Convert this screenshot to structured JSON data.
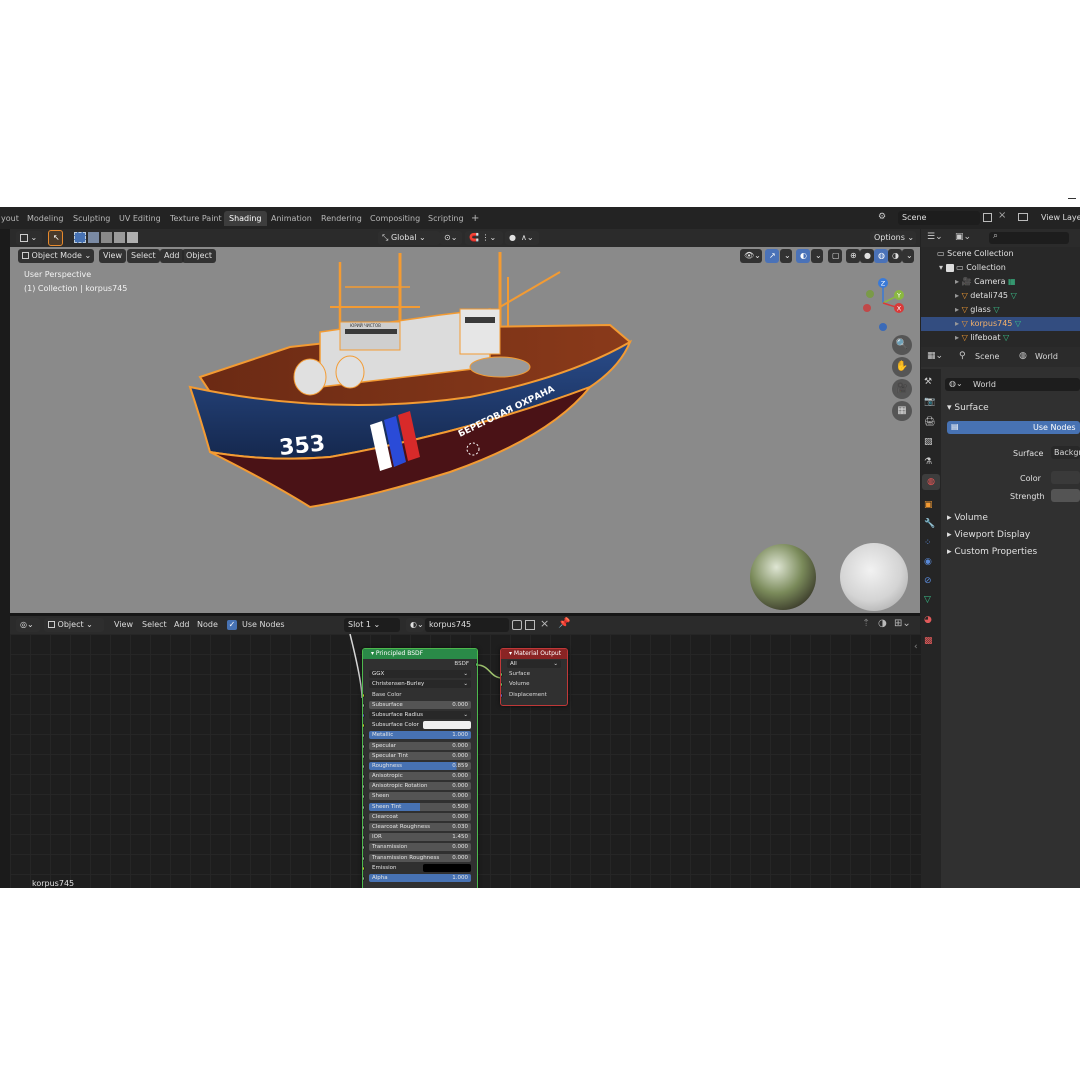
{
  "workspace_tabs": [
    "yout",
    "Modeling",
    "Sculpting",
    "UV Editing",
    "Texture Paint",
    "Shading",
    "Animation",
    "Rendering",
    "Compositing",
    "Scripting",
    "+"
  ],
  "active_tab": "Shading",
  "top_right": {
    "scene": "Scene",
    "view_layer": "View Layer"
  },
  "viewport": {
    "mode": "Object Mode",
    "menus": [
      "View",
      "Select",
      "Add",
      "Object"
    ],
    "transform_orientation": "Global",
    "options_label": "Options",
    "perspective_label": "User Perspective",
    "collection_label": "(1) Collection | korpus745",
    "hull_number": "353",
    "hull_text": "БЕРЕГОВАЯ ОХРАНА",
    "bridge_sign": "ЮРИЙ ЧИСТОВ",
    "gizmo": {
      "x": "X",
      "y": "Y",
      "z": "Z"
    }
  },
  "node_editor": {
    "editor_type": "Object",
    "menus": [
      "View",
      "Select",
      "Add",
      "Node"
    ],
    "use_nodes_label": "Use Nodes",
    "slot": "Slot 1",
    "material": "korpus745",
    "footer_label": "korpus745",
    "bsdf_node": {
      "title": "Principled BSDF",
      "output": "BSDF",
      "distribution": "GGX",
      "subsurface_method": "Christensen-Burley",
      "rows": [
        {
          "label": "Base Color",
          "value": "",
          "kind": "plain"
        },
        {
          "label": "Subsurface",
          "value": "0.000",
          "kind": "field"
        },
        {
          "label": "Subsurface Radius",
          "value": "",
          "kind": "dropdown"
        },
        {
          "label": "Subsurface Color",
          "value": "",
          "kind": "color"
        },
        {
          "label": "Metallic",
          "value": "1.000",
          "kind": "field",
          "fill": 1.0
        },
        {
          "label": "Specular",
          "value": "0.000",
          "kind": "field"
        },
        {
          "label": "Specular Tint",
          "value": "0.000",
          "kind": "field"
        },
        {
          "label": "Roughness",
          "value": "0.859",
          "kind": "field",
          "fill": 0.859
        },
        {
          "label": "Anisotropic",
          "value": "0.000",
          "kind": "field"
        },
        {
          "label": "Anisotropic Rotation",
          "value": "0.000",
          "kind": "field"
        },
        {
          "label": "Sheen",
          "value": "0.000",
          "kind": "field"
        },
        {
          "label": "Sheen Tint",
          "value": "0.500",
          "kind": "field",
          "fill": 0.5
        },
        {
          "label": "Clearcoat",
          "value": "0.000",
          "kind": "field"
        },
        {
          "label": "Clearcoat Roughness",
          "value": "0.030",
          "kind": "field"
        },
        {
          "label": "IOR",
          "value": "1.450",
          "kind": "field"
        },
        {
          "label": "Transmission",
          "value": "0.000",
          "kind": "field"
        },
        {
          "label": "Transmission Roughness",
          "value": "0.000",
          "kind": "field"
        },
        {
          "label": "Emission",
          "value": "",
          "kind": "black"
        },
        {
          "label": "Alpha",
          "value": "1.000",
          "kind": "field",
          "fill": 1.0
        }
      ]
    },
    "output_node": {
      "title": "Material Output",
      "target": "All",
      "inputs": [
        "Surface",
        "Volume",
        "Displacement"
      ]
    }
  },
  "outliner": {
    "root": "Scene Collection",
    "collection": "Collection",
    "items": [
      {
        "name": "Camera",
        "selected": false
      },
      {
        "name": "detali745",
        "selected": false
      },
      {
        "name": "glass",
        "selected": false
      },
      {
        "name": "korpus745",
        "selected": true
      },
      {
        "name": "lifeboat",
        "selected": false
      }
    ]
  },
  "properties": {
    "breadcrumb_scene": "Scene",
    "breadcrumb_world": "World",
    "world_name": "World",
    "surface_panel": "Surface",
    "use_nodes": "Use Nodes",
    "surface_label": "Surface",
    "surface_value": "Backgr",
    "color_label": "Color",
    "strength_label": "Strength",
    "collapsed_panels": [
      "Volume",
      "Viewport Display",
      "Custom Properties"
    ]
  },
  "colors": {
    "selection_orange": "#f39b33",
    "accent_blue": "#4772b3",
    "hull_blue": "#1f3a6e",
    "hull_red": "#5a1418"
  }
}
